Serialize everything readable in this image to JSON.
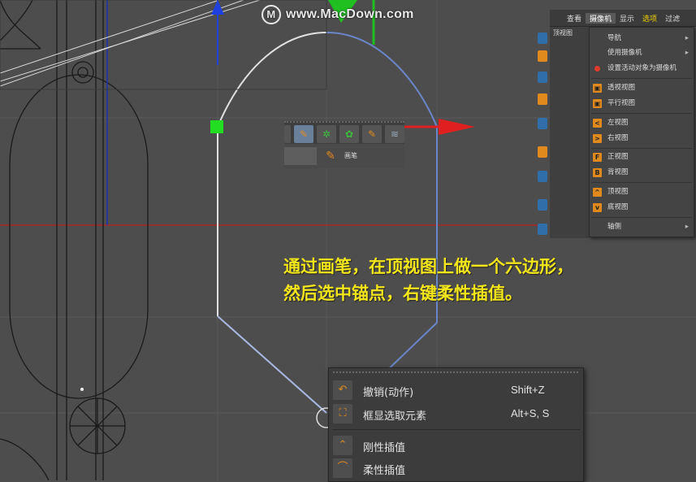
{
  "watermark": {
    "logo": "M",
    "text": "www.MacDown.com"
  },
  "menubar": {
    "items": [
      "查看",
      "摄像机",
      "显示",
      "选项",
      "过滤"
    ]
  },
  "side_panel": {
    "title": "顶视图"
  },
  "camera_menu": {
    "items": [
      {
        "label": "导航",
        "arrow": "▸"
      },
      {
        "label": "使用摄像机",
        "arrow": "▸"
      },
      {
        "label": "设置活动对象为摄像机"
      },
      {
        "label": "透视视图",
        "icon": "▣"
      },
      {
        "label": "平行视图",
        "icon": "▣"
      },
      {
        "label": "左视图",
        "icon": "<"
      },
      {
        "label": "右视图",
        "icon": ">"
      },
      {
        "label": "正视图",
        "icon": "F"
      },
      {
        "label": "背视图",
        "icon": "B"
      },
      {
        "label": "顶视图",
        "icon": "^"
      },
      {
        "label": "底视图",
        "icon": "v"
      },
      {
        "label": "轴侧",
        "arrow": "▸"
      }
    ]
  },
  "pen_popup": {
    "label": "画笔"
  },
  "caption": {
    "line1": "通过画笔，在顶视图上做一个六边形，",
    "line2": "然后选中锚点，右键柔性插值。"
  },
  "context_menu": {
    "items": [
      {
        "label": "撤销(动作)",
        "shortcut": "Shift+Z"
      },
      {
        "label": "框显选取元素",
        "shortcut": "Alt+S, S"
      },
      {
        "label": "刚性插值",
        "shortcut": ""
      },
      {
        "label": "柔性插值",
        "shortcut": ""
      }
    ]
  },
  "colors": {
    "viewport_bg": "#4d4d4d",
    "grid": "#5a5a5a",
    "x_axis": "#e02020",
    "y_axis": "#2040e0",
    "z_axis": "#20c020",
    "spline_white": "#e0e0e0",
    "spline_blue": "#6b86c8",
    "caption": "#f2e51c",
    "accent_orange": "#e08a1e"
  }
}
